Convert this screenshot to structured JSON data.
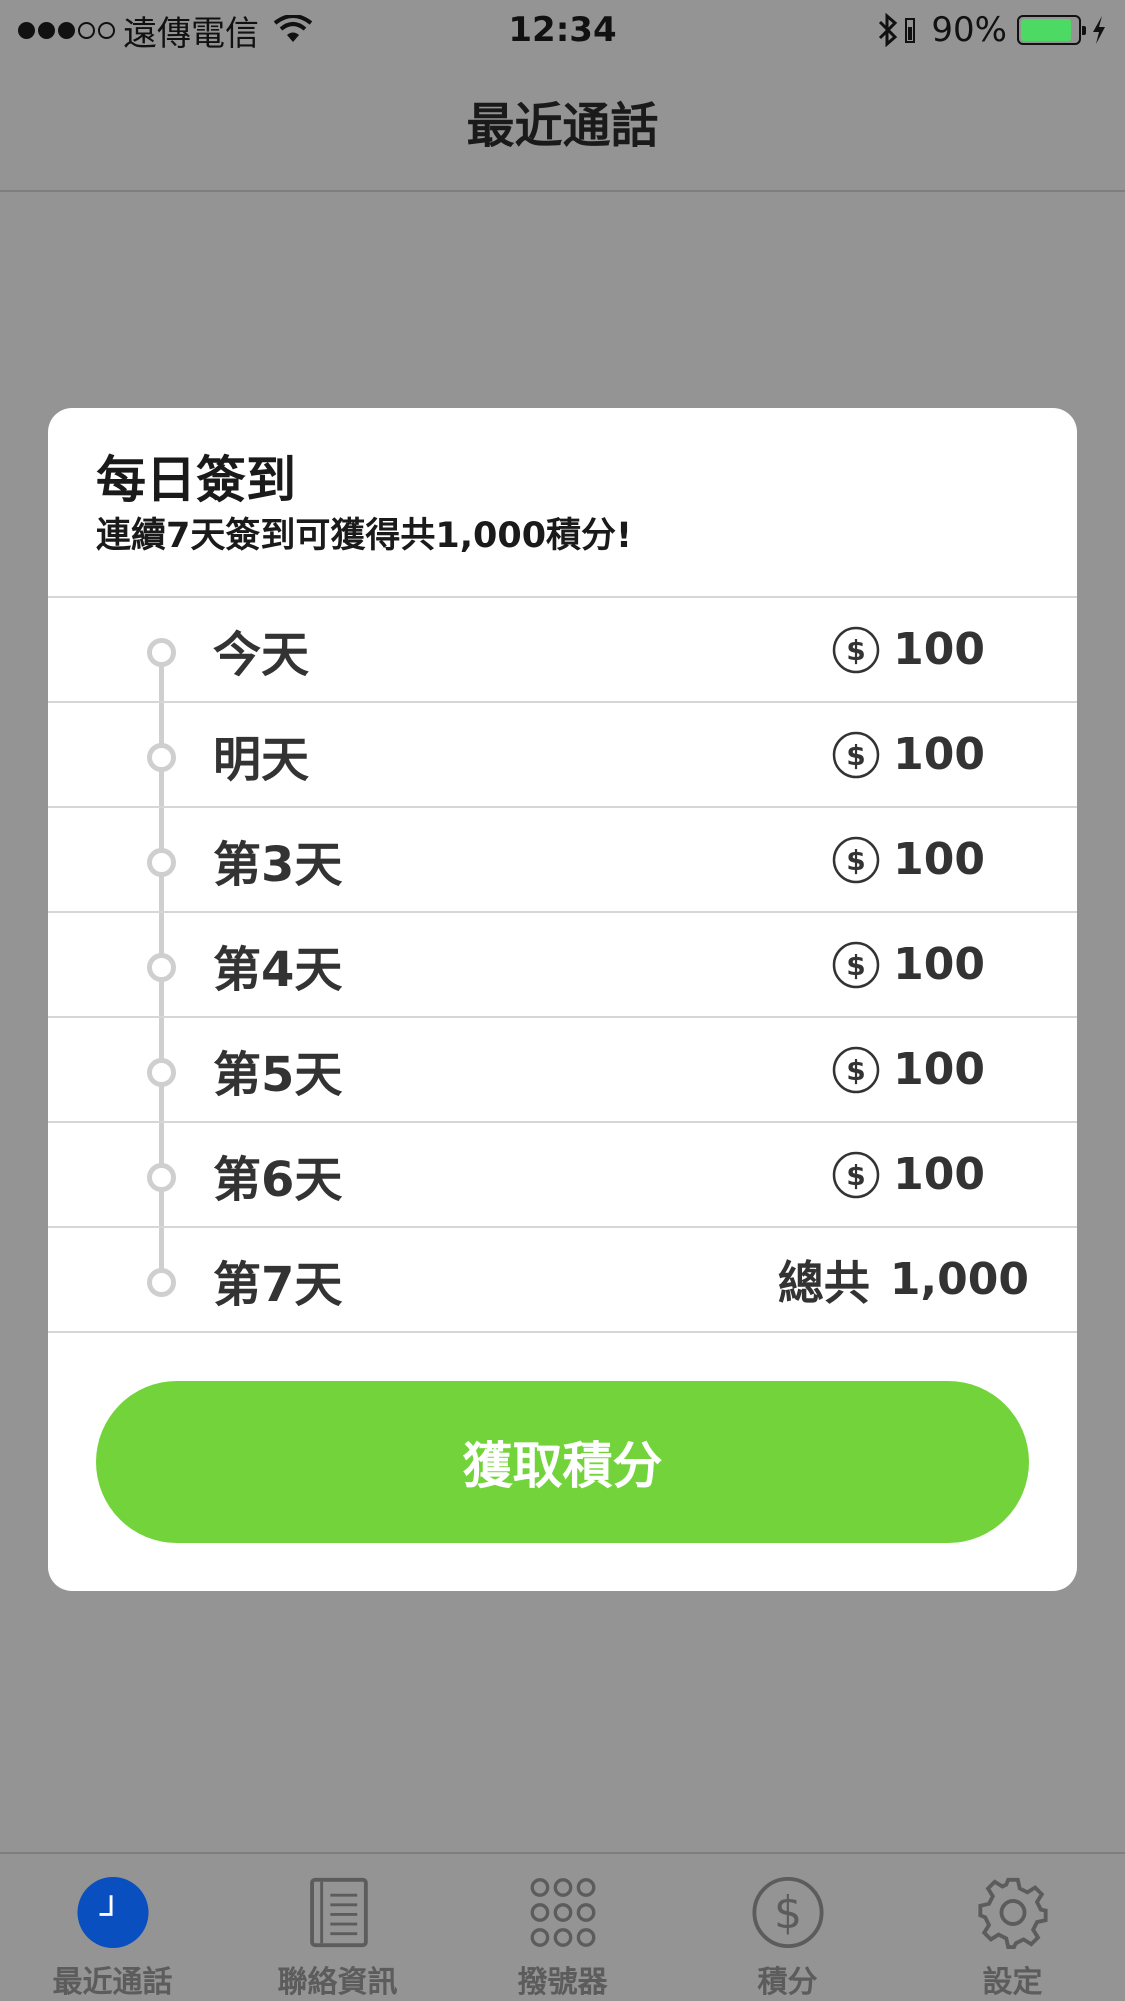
{
  "status_bar": {
    "carrier": "遠傳電信",
    "time": "12:34",
    "battery_percent": "90%",
    "battery_level": 0.9,
    "battery_color": "#4cd964",
    "icons": [
      "signal-dots",
      "wifi-icon",
      "bluetooth-icon",
      "battery-icon",
      "charging-icon"
    ]
  },
  "nav": {
    "title": "最近通話"
  },
  "dialog": {
    "title": "每日簽到",
    "subtitle": "連續7天簽到可獲得共1,000積分!",
    "days": [
      {
        "label": "今天",
        "reward": "100",
        "icon": "coin-icon"
      },
      {
        "label": "明天",
        "reward": "100",
        "icon": "coin-icon"
      },
      {
        "label": "第3天",
        "reward": "100",
        "icon": "coin-icon"
      },
      {
        "label": "第4天",
        "reward": "100",
        "icon": "coin-icon"
      },
      {
        "label": "第5天",
        "reward": "100",
        "icon": "coin-icon"
      },
      {
        "label": "第6天",
        "reward": "100",
        "icon": "coin-icon"
      },
      {
        "label": "第7天",
        "total_label": "總共",
        "reward": "1,000"
      }
    ],
    "button_label": "獲取積分",
    "button_color": "#72d43a"
  },
  "tab_bar": {
    "active_color": "#0a4fbf",
    "tabs": [
      {
        "label": "最近通話",
        "icon": "clock-icon",
        "active": true
      },
      {
        "label": "聯絡資訊",
        "icon": "contacts-book-icon",
        "active": false
      },
      {
        "label": "撥號器",
        "icon": "keypad-icon",
        "active": false
      },
      {
        "label": "積分",
        "icon": "dollar-coin-icon",
        "active": false
      },
      {
        "label": "設定",
        "icon": "gear-icon",
        "active": false
      }
    ]
  }
}
